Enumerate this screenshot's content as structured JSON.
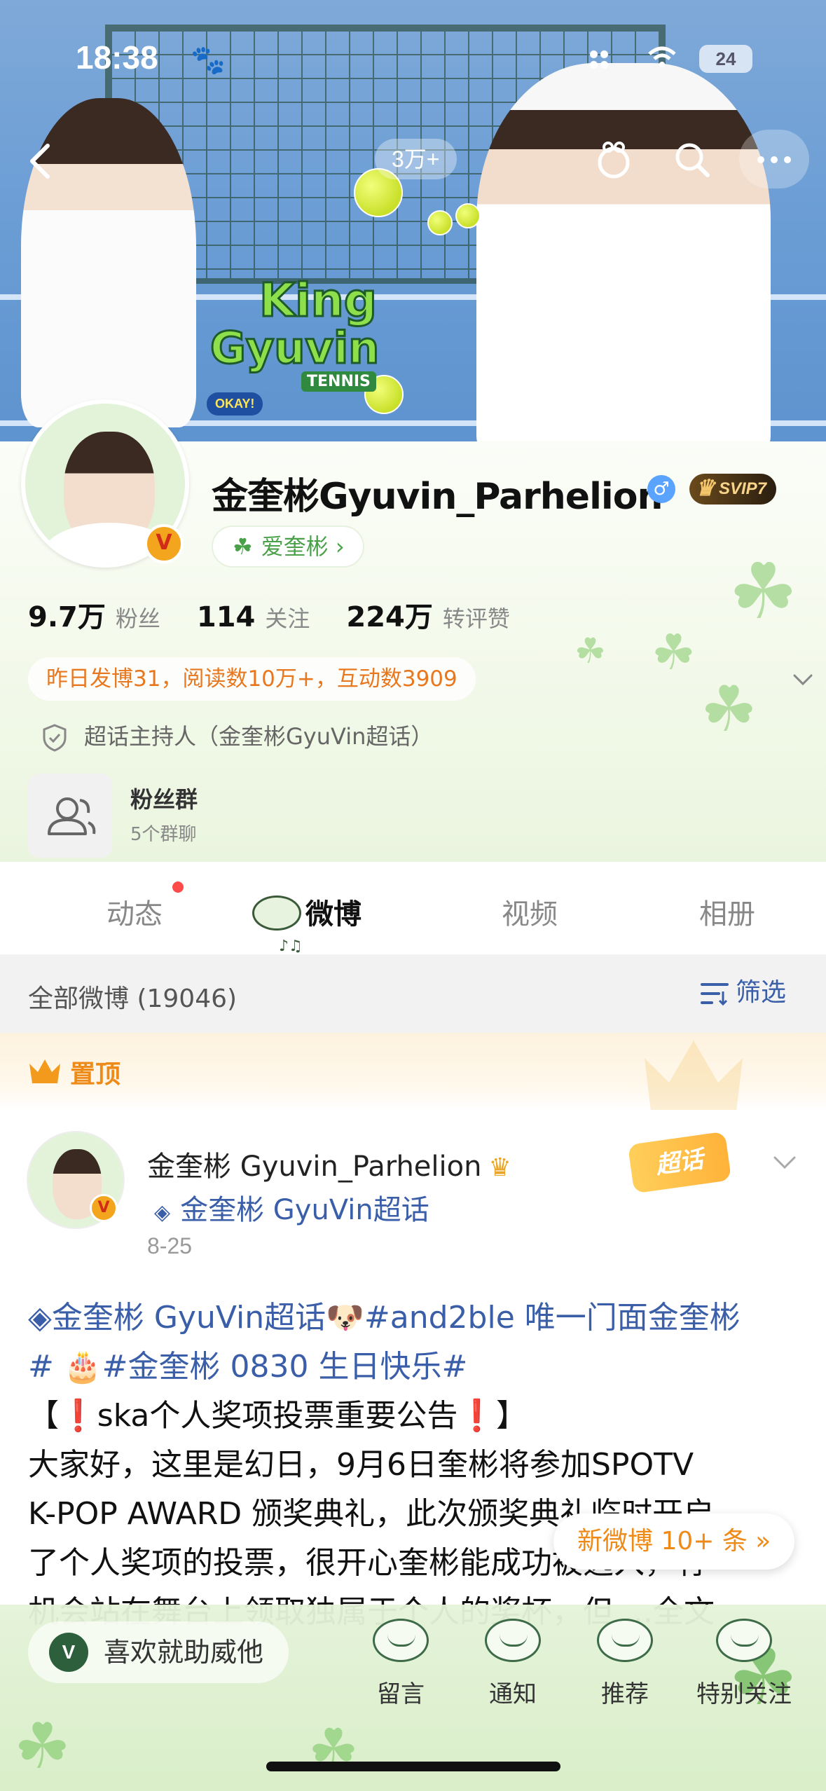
{
  "status_bar": {
    "time": "18:38",
    "battery": "24"
  },
  "header": {
    "followers_pill": "3万+"
  },
  "banner": {
    "logo_line1": "King",
    "logo_line2": "Gyuvin",
    "logo_line3": "TENNIS",
    "okay_badge": "OKAY!"
  },
  "profile": {
    "name": "金奎彬Gyuvin_Parhelion",
    "gender_symbol": "♂",
    "svip": "SVIP7",
    "fan_tag": "爱奎彬 ›",
    "stats": [
      {
        "value": "9.7万",
        "label": "粉丝"
      },
      {
        "value": "114",
        "label": "关注"
      },
      {
        "value": "224万",
        "label": "转评赞"
      }
    ],
    "activity": "昨日发博31，阅读数10万+，互动数3909",
    "host_line": "超话主持人（金奎彬GyuVin超话）",
    "fan_group": {
      "title": "粉丝群",
      "subtitle": "5个群聊"
    }
  },
  "tabs": [
    {
      "label": "动态"
    },
    {
      "label": "微博"
    },
    {
      "label": "视频"
    },
    {
      "label": "相册"
    }
  ],
  "feed": {
    "title": "全部微博 (19046)",
    "filter_label": "筛选",
    "pinned_label": "置顶"
  },
  "post": {
    "author": "金奎彬 Gyuvin_Parhelion",
    "topic": "金奎彬 GyuVin超话",
    "date": "8-25",
    "sticker": "超话",
    "lines": [
      {
        "tag1": "金奎彬 GyuVin超话",
        "emoji1": "🐶",
        "tag2": "#and2ble 唯一门面金奎彬"
      },
      {
        "tag3": "#",
        "emoji2": "🎂",
        "tag4": "#金奎彬 0830 生日快乐#"
      },
      {
        "text": "【❗ska个人奖项投票重要公告❗】"
      },
      {
        "text": "  大家好，这里是幻日，9月6日奎彬将参加SPOTV"
      },
      {
        "text": "K-POP AWARD 颁奖典礼，此次颁奖典礼临时开启"
      },
      {
        "text": "了个人奖项的投票，很开心奎彬能成功被选入，有"
      },
      {
        "text": "机会站在舞台上领取独属于个人的奖杯，但 ...全文"
      }
    ]
  },
  "new_posts": "新微博 10+ 条 »",
  "bottom_bar": {
    "like_badge": "V",
    "like_text": "喜欢就助威他",
    "nav": [
      {
        "label": "留言"
      },
      {
        "label": "通知"
      },
      {
        "label": "推荐"
      },
      {
        "label": "特别关注"
      }
    ]
  }
}
